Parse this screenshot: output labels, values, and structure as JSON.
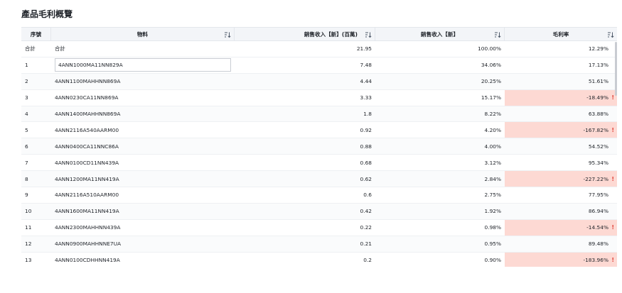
{
  "title": "產品毛利概覽",
  "columns": {
    "idx": "序號",
    "material": "物料",
    "sales": "銷售收入【新】(百萬)",
    "pct": "銷售收入【新】",
    "margin": "毛利率"
  },
  "total": {
    "idx": "合計",
    "material": "合計",
    "sales": "21.95",
    "pct": "100.00%",
    "margin": "12.29%"
  },
  "rows": [
    {
      "idx": "1",
      "material": "4ANN1000MA11NN829A",
      "sales": "7.48",
      "pct": "34.06%",
      "margin": "17.13%",
      "negative": false
    },
    {
      "idx": "2",
      "material": "4ANN1100MAHHNN869A",
      "sales": "4.44",
      "pct": "20.25%",
      "margin": "51.61%",
      "negative": false
    },
    {
      "idx": "3",
      "material": "4ANN0230CA11NN869A",
      "sales": "3.33",
      "pct": "15.17%",
      "margin": "-18.49%",
      "negative": true
    },
    {
      "idx": "4",
      "material": "4ANN1400MAHHNN869A",
      "sales": "1.8",
      "pct": "8.22%",
      "margin": "63.88%",
      "negative": false
    },
    {
      "idx": "5",
      "material": "4ANN2116A540AARM00",
      "sales": "0.92",
      "pct": "4.20%",
      "margin": "-167.82%",
      "negative": true
    },
    {
      "idx": "6",
      "material": "4ANN0400CA11NNC86A",
      "sales": "0.88",
      "pct": "4.00%",
      "margin": "54.52%",
      "negative": false
    },
    {
      "idx": "7",
      "material": "4ANN0100CD11NN439A",
      "sales": "0.68",
      "pct": "3.12%",
      "margin": "95.34%",
      "negative": false
    },
    {
      "idx": "8",
      "material": "4ANN1200MA11NN419A",
      "sales": "0.62",
      "pct": "2.84%",
      "margin": "-227.22%",
      "negative": true
    },
    {
      "idx": "9",
      "material": "4ANN2116A510AARM00",
      "sales": "0.6",
      "pct": "2.75%",
      "margin": "77.95%",
      "negative": false
    },
    {
      "idx": "10",
      "material": "4ANN1600MA11NN419A",
      "sales": "0.42",
      "pct": "1.92%",
      "margin": "86.94%",
      "negative": false
    },
    {
      "idx": "11",
      "material": "4ANN2300MAHHNN439A",
      "sales": "0.22",
      "pct": "0.98%",
      "margin": "-14.54%",
      "negative": true
    },
    {
      "idx": "12",
      "material": "4ANN0900MAHHNNE7UA",
      "sales": "0.21",
      "pct": "0.95%",
      "margin": "89.48%",
      "negative": false
    },
    {
      "idx": "13",
      "material": "4ANN0100CDHHNN419A",
      "sales": "0.2",
      "pct": "0.90%",
      "margin": "-183.96%",
      "negative": true
    }
  ],
  "warning_glyph": "!",
  "colors": {
    "negative_bg": "#fdd9d3",
    "warning": "#e0463d"
  },
  "selected_row_index": 0
}
